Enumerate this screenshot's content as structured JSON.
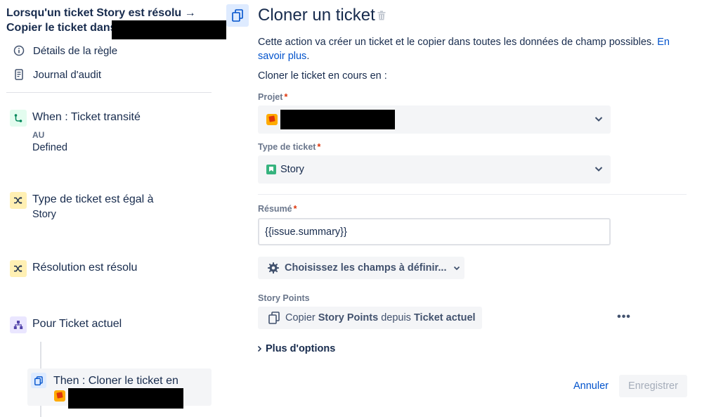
{
  "rule": {
    "title_line1": "Lorsqu'un ticket Story est résolu →",
    "title_line2": "Copier le ticket dans"
  },
  "nav": [
    {
      "label": "Détails de la règle",
      "icon": "info-icon"
    },
    {
      "label": "Journal d'audit",
      "icon": "document-icon"
    }
  ],
  "steps": {
    "trigger": {
      "label": "When : Ticket transité",
      "sub_key": "AU",
      "sub_value": "Defined",
      "icon": "transition-icon"
    },
    "condition1": {
      "label": "Type de ticket est égal à",
      "sub_value": "Story",
      "icon": "shuffle-icon"
    },
    "condition2": {
      "label": "Résolution est résolu",
      "icon": "shuffle-icon"
    },
    "branch": {
      "label": "Pour Ticket actuel",
      "icon": "hierarchy-icon"
    },
    "action": {
      "label": "Then : Cloner le ticket en",
      "icon": "copy-icon"
    }
  },
  "panel": {
    "title": "Cloner un ticket",
    "description": "Cette action va créer un ticket et le copier dans toutes les données de champ possibles.",
    "learn_more": "En savoir plus",
    "period": ".",
    "clone_into": "Cloner le ticket en cours en :",
    "project_label": "Projet",
    "issue_type_label": "Type de ticket",
    "issue_type_value": "Story",
    "summary_label": "Résumé",
    "summary_value": "{{issue.summary}}",
    "required_mark": "*",
    "choose_fields": "Choisissez les champs à définir...",
    "story_points_label": "Story Points",
    "copy_prefix": "Copier",
    "copy_field": "Story Points",
    "copy_from": "depuis",
    "copy_source": "Ticket actuel",
    "more_dots": "•••",
    "more_options": "Plus d'options",
    "cancel": "Annuler",
    "save": "Enregistrer"
  },
  "colors": {
    "accent": "#0052cc",
    "text": "#172b4d",
    "required": "#de350b",
    "field_bg": "#f4f5f7"
  }
}
